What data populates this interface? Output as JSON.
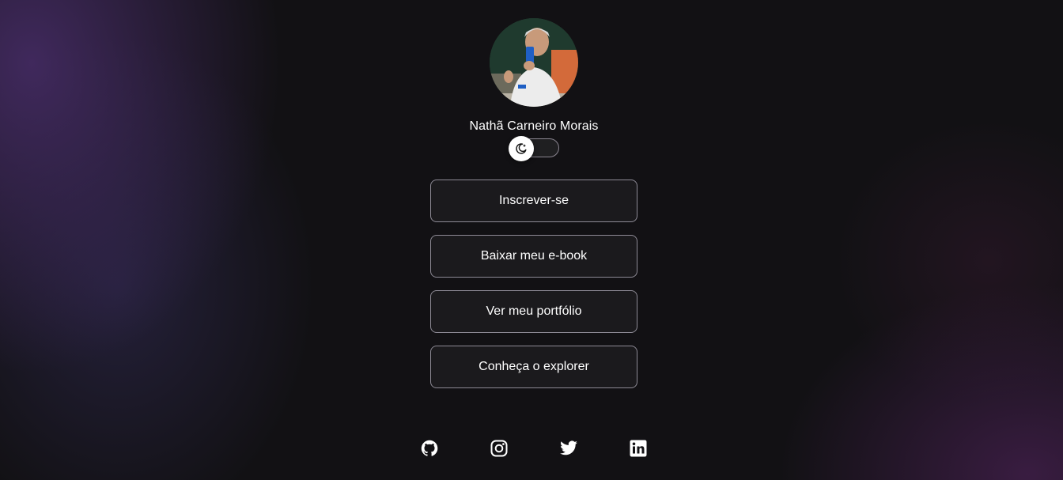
{
  "profile": {
    "name": "Nathã Carneiro Morais",
    "avatar_alt": "profile-photo"
  },
  "theme_switch": {
    "icon": "moon-icon",
    "state": "dark"
  },
  "links": [
    {
      "label": "Inscrever-se"
    },
    {
      "label": "Baixar meu e-book"
    },
    {
      "label": "Ver meu portfólio"
    },
    {
      "label": "Conheça o explorer"
    }
  ],
  "socials": [
    {
      "icon": "github-icon"
    },
    {
      "icon": "instagram-icon"
    },
    {
      "icon": "twitter-icon"
    },
    {
      "icon": "linkedin-icon"
    }
  ],
  "colors": {
    "background": "#121114",
    "glow_purple": "#482d69",
    "glow_magenta": "#462050",
    "button_border": "#8d8a95",
    "text": "#ffffff"
  }
}
